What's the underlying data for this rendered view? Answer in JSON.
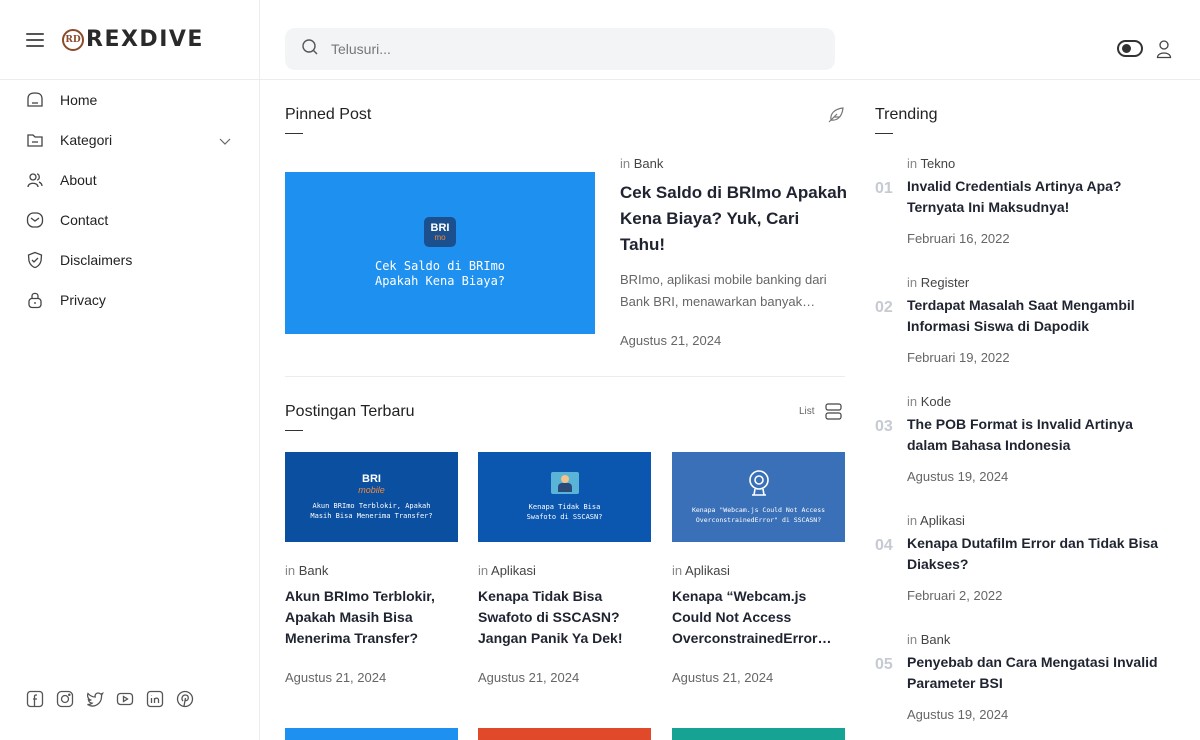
{
  "brand": {
    "logo_badge": "RD",
    "logo_text": "REXDIVE"
  },
  "nav": {
    "items": [
      {
        "label": "Home",
        "icon": "home-icon"
      },
      {
        "label": "Kategori",
        "icon": "folder-icon"
      },
      {
        "label": "About",
        "icon": "users-icon"
      },
      {
        "label": "Contact",
        "icon": "mail-icon"
      },
      {
        "label": "Disclaimers",
        "icon": "shield-icon"
      },
      {
        "label": "Privacy",
        "icon": "lock-icon"
      }
    ]
  },
  "socials": [
    "facebook-icon",
    "instagram-icon",
    "twitter-icon",
    "youtube-icon",
    "linkedin-icon",
    "pinterest-icon"
  ],
  "search": {
    "placeholder": "Telusuri..."
  },
  "pinned": {
    "section_title": "Pinned Post",
    "image_badge_top": "BRI",
    "image_badge_bottom": "mo",
    "image_line1": "Cek Saldo di BRImo",
    "image_line2": "Apakah Kena Biaya?",
    "in": "in",
    "category": "Bank",
    "title": "Cek Saldo di BRImo Apakah Kena Biaya? Yuk, Cari Tahu!",
    "excerpt": "BRImo, aplikasi mobile banking dari Bank BRI, menawarkan banyak…",
    "date": "Agustus 21, 2024"
  },
  "latest": {
    "section_title": "Postingan Terbaru",
    "view_label": "List",
    "posts": [
      {
        "in": "in",
        "category": "Bank",
        "title": "Akun BRImo Terblokir, Apakah Masih Bisa Menerima Transfer?",
        "date": "Agustus 21, 2024",
        "img_brand": "BRI",
        "img_brand_sub": "mobile",
        "img_line1": "Akun BRImo Terblokir, Apakah",
        "img_line2": "Masih Bisa Menerima Transfer?",
        "img_color": "#0b4fa0"
      },
      {
        "in": "in",
        "category": "Aplikasi",
        "title": "Kenapa Tidak Bisa Swafoto di SSCASN? Jangan Panik Ya Dek!",
        "date": "Agustus 21, 2024",
        "img_line1": "Kenapa Tidak Bisa",
        "img_line2": "Swafoto di SSCASN?",
        "img_color": "#0b57b0"
      },
      {
        "in": "in",
        "category": "Aplikasi",
        "title": "Kenapa “Webcam.js Could Not Access OverconstrainedError…",
        "date": "Agustus 21, 2024",
        "img_line1": "Kenapa \"Webcam.js Could Not Access",
        "img_line2": "OverconstrainedError\" di SSCASN?",
        "img_color": "#3a70b8"
      }
    ],
    "strip_colors": [
      "#1e90ef",
      "#e04a2a",
      "#17a394"
    ]
  },
  "trending": {
    "section_title": "Trending",
    "items": [
      {
        "num": "01",
        "in": "in",
        "category": "Tekno",
        "title": "Invalid Credentials Artinya Apa? Ternyata Ini Maksudnya!",
        "date": "Februari 16, 2022"
      },
      {
        "num": "02",
        "in": "in",
        "category": "Register",
        "title": "Terdapat Masalah Saat Mengambil Informasi Siswa di Dapodik",
        "date": "Februari 19, 2022"
      },
      {
        "num": "03",
        "in": "in",
        "category": "Kode",
        "title": "The POB Format is Invalid Artinya dalam Bahasa Indonesia",
        "date": "Agustus 19, 2024"
      },
      {
        "num": "04",
        "in": "in",
        "category": "Aplikasi",
        "title": "Kenapa Dutafilm Error dan Tidak Bisa Diakses?",
        "date": "Februari 2, 2022"
      },
      {
        "num": "05",
        "in": "in",
        "category": "Bank",
        "title": "Penyebab dan Cara Mengatasi Invalid Parameter BSI",
        "date": "Agustus 19, 2024"
      }
    ]
  }
}
